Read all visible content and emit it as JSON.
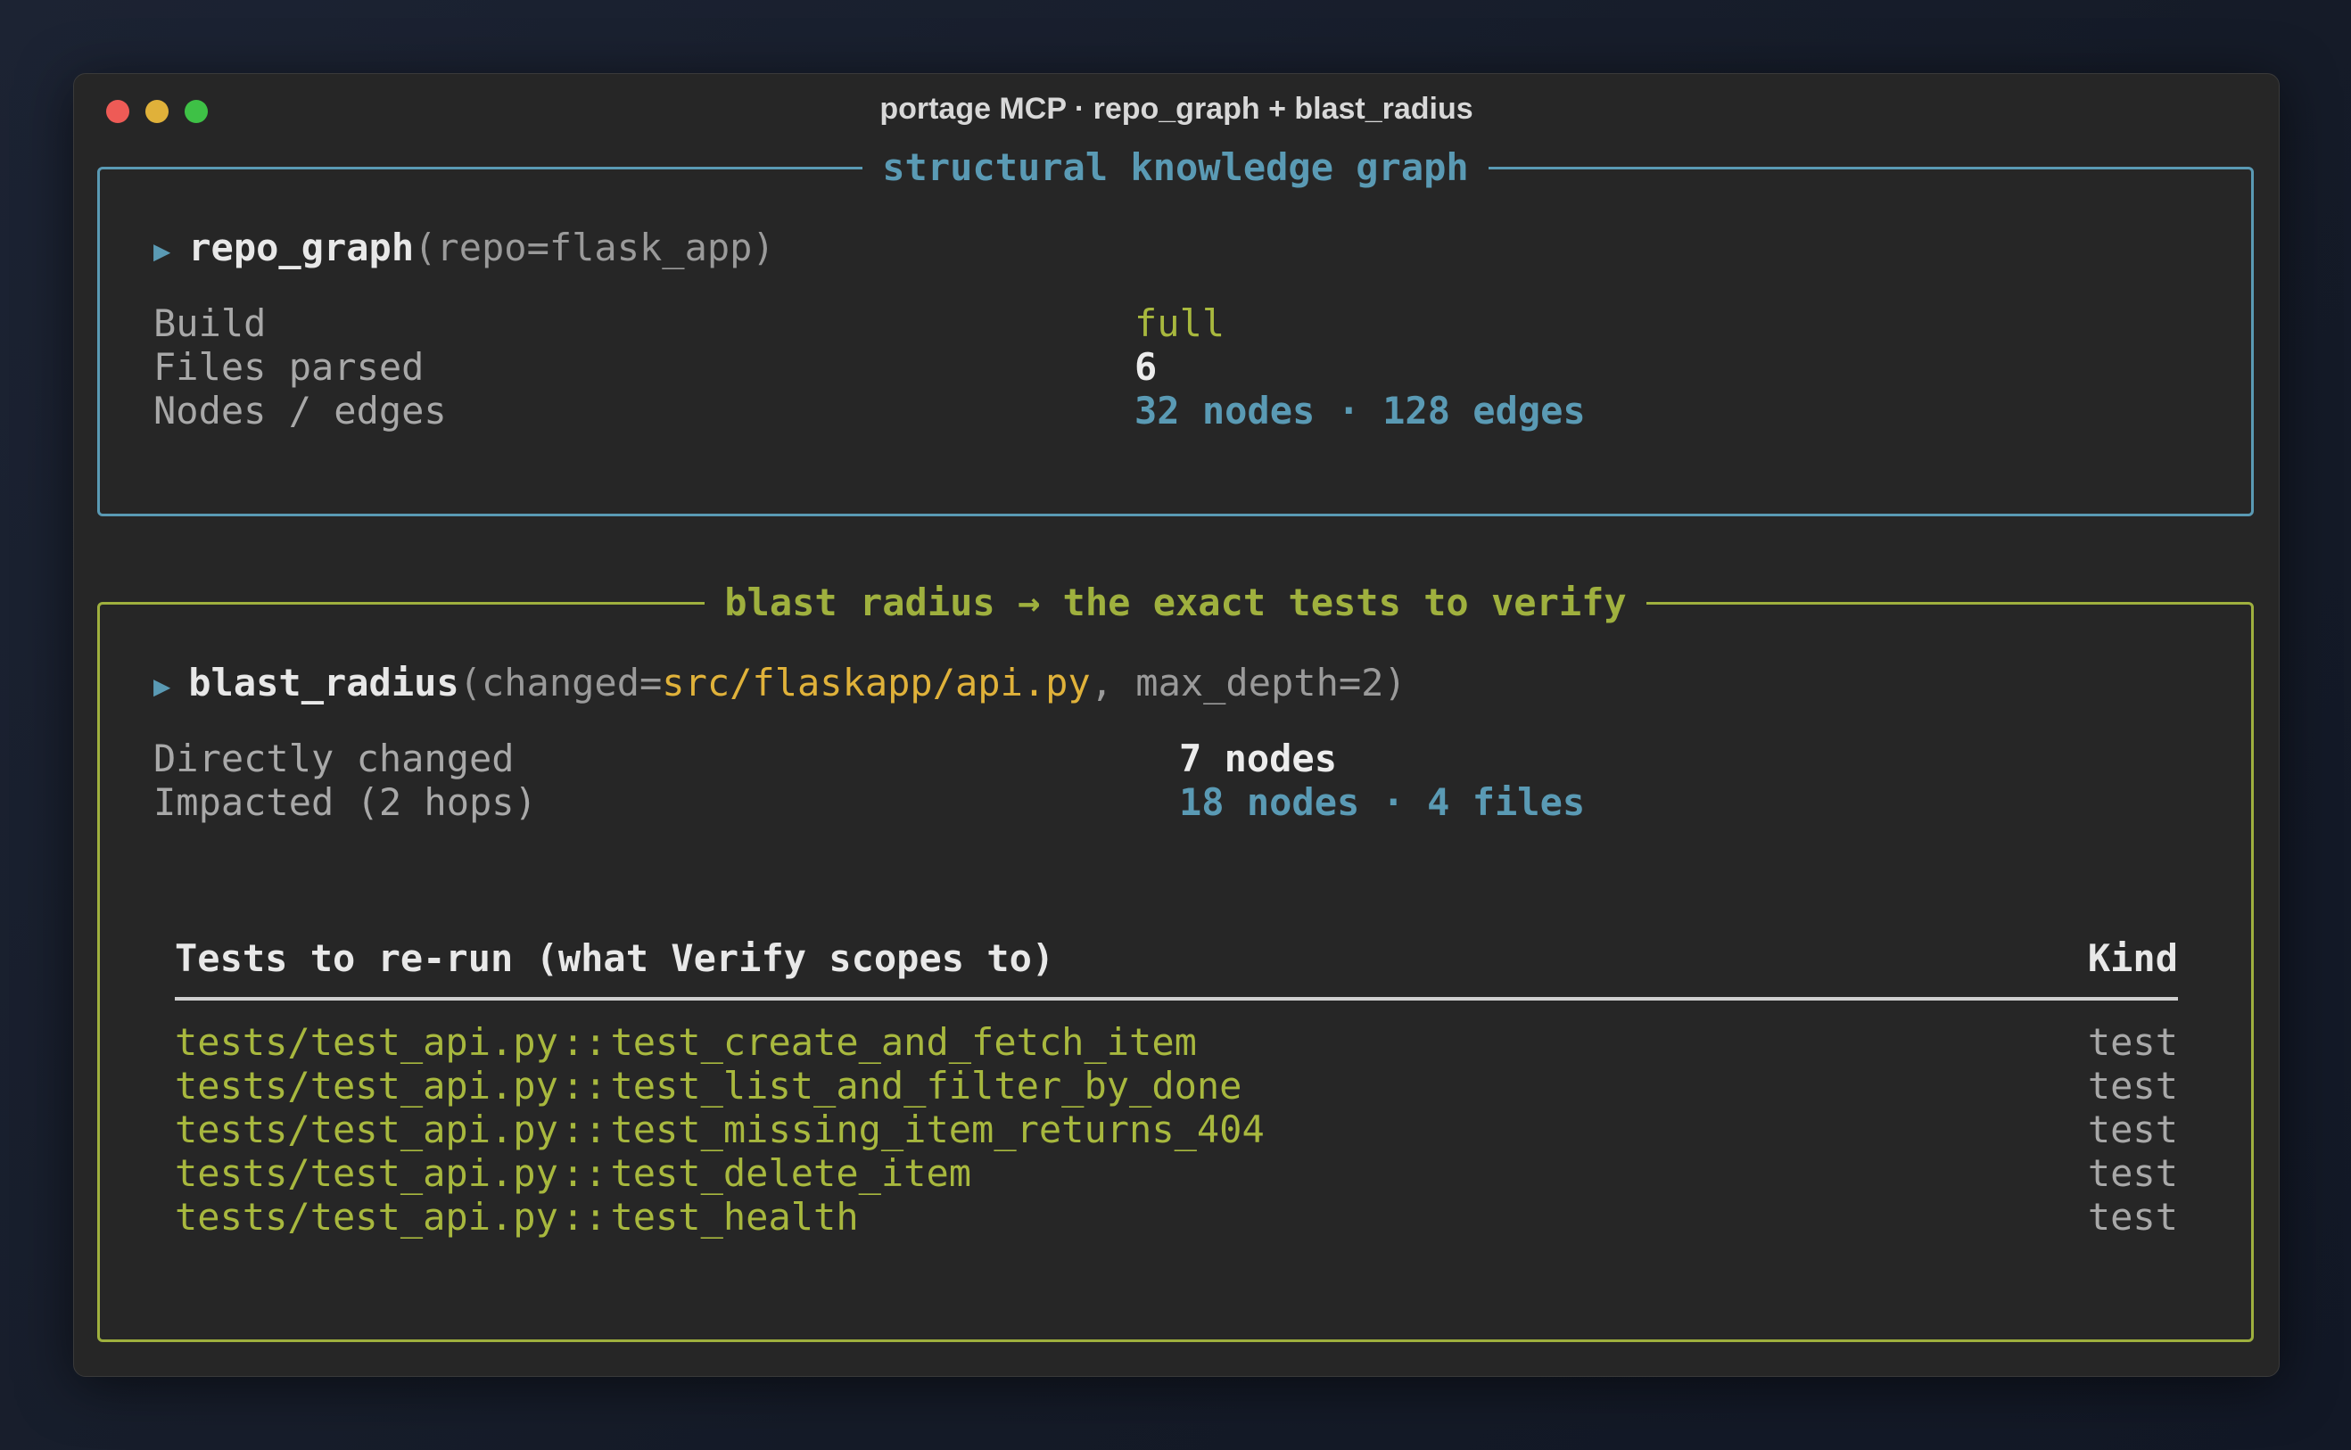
{
  "window": {
    "title": "portage MCP · repo_graph + blast_radius"
  },
  "graph_panel": {
    "legend": "structural knowledge graph",
    "call": {
      "name": "repo_graph",
      "args": "(repo=flask_app)"
    },
    "rows": [
      {
        "label": "Build",
        "value": "full"
      },
      {
        "label": "Files parsed",
        "value": "6"
      },
      {
        "label": "Nodes / edges",
        "value": "32 nodes · 128 edges"
      }
    ]
  },
  "blast_panel": {
    "legend": "blast radius → the exact tests to verify",
    "call": {
      "name": "blast_radius",
      "args_prefix": "(changed=",
      "changed": "src/flaskapp/api.py",
      "args_suffix": ", max_depth=2)"
    },
    "rows": [
      {
        "label": "Directly changed",
        "value": "7 nodes"
      },
      {
        "label": "Impacted (2 hops)",
        "value": "18 nodes · 4 files"
      }
    ],
    "table": {
      "header": "Tests to re-run (what Verify scopes to)",
      "kind_header": "Kind",
      "rows": [
        {
          "file": "tests/test_api.py",
          "sep": "::",
          "test": "test_create_and_fetch_item",
          "kind": "test"
        },
        {
          "file": "tests/test_api.py",
          "sep": "::",
          "test": "test_list_and_filter_by_done",
          "kind": "test"
        },
        {
          "file": "tests/test_api.py",
          "sep": "::",
          "test": "test_missing_item_returns_404",
          "kind": "test"
        },
        {
          "file": "tests/test_api.py",
          "sep": "::",
          "test": "test_delete_item",
          "kind": "test"
        },
        {
          "file": "tests/test_api.py",
          "sep": "::",
          "test": "test_health",
          "kind": "test"
        }
      ]
    }
  },
  "colors": {
    "graph_accent": "#5a9ab4",
    "blast_accent": "#9fb03e",
    "arg_highlight": "#e0b23a"
  }
}
